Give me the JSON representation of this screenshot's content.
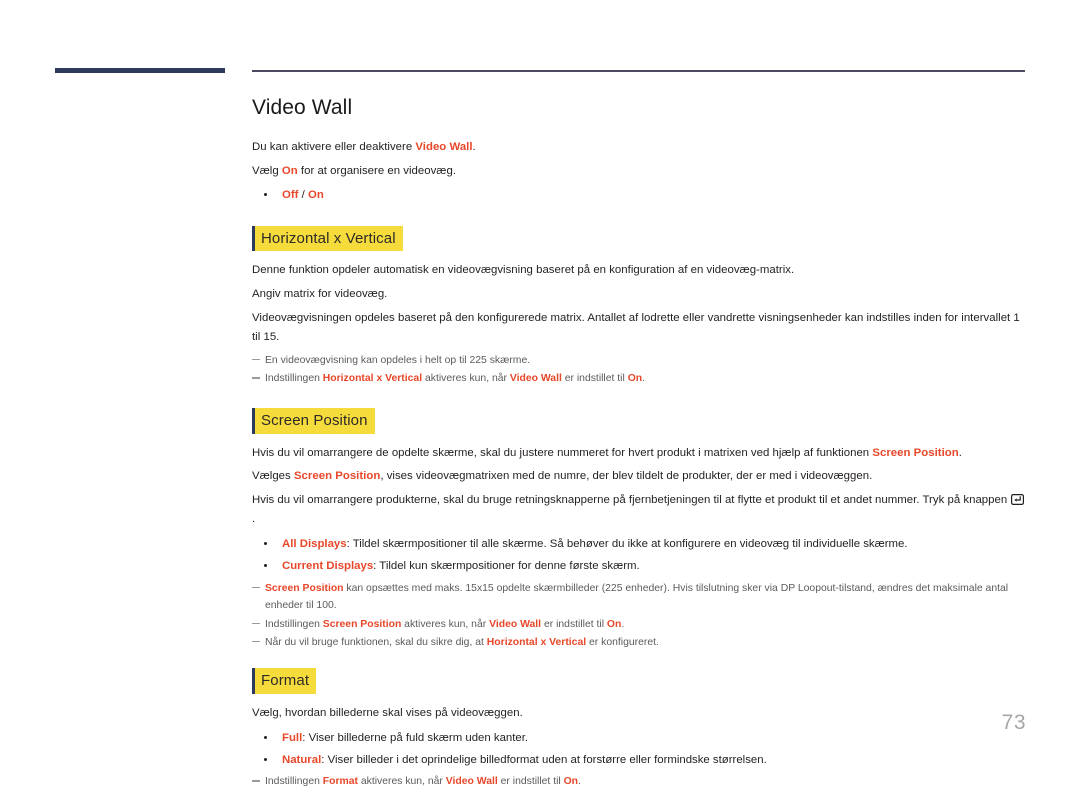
{
  "page": {
    "number": "73",
    "accent_color": "#e8472a",
    "highlight_color": "#f5dc3c",
    "rule_color": "#4a4a63",
    "margin_bar_color": "#2c3a5c"
  },
  "title": "Video Wall",
  "intro": {
    "line1_pre": "Du kan aktivere eller deaktivere ",
    "line1_accent": "Video Wall",
    "line1_post": ".",
    "line2_pre": "Vælg ",
    "line2_accent": "On",
    "line2_post": " for at organisere en videovæg.",
    "bullet1_a": "Off",
    "bullet1_sep": " / ",
    "bullet1_b": "On"
  },
  "sections": [
    {
      "heading": "Horizontal x Vertical",
      "p1": "Denne funktion opdeler automatisk en videovægvisning baseret på en konfiguration af en videovæg-matrix.",
      "p2": "Angiv matrix for videovæg.",
      "p3": "Videovægvisningen opdeles baseret på den konfigurerede matrix. Antallet af lodrette eller vandrette visningsenheder kan indstilles inden for intervallet 1 til 15.",
      "note1": "En videovægvisning kan opdeles i helt op til 225 skærme.",
      "note2_pre": "Indstillingen ",
      "note2_a": "Horizontal x Vertical",
      "note2_mid": " aktiveres kun, når ",
      "note2_b": "Video Wall",
      "note2_mid2": " er indstillet til ",
      "note2_c": "On",
      "note2_post": "."
    },
    {
      "heading": "Screen Position",
      "p1_pre": "Hvis du vil omarrangere de opdelte skærme, skal du justere nummeret for hvert produkt i matrixen ved hjælp af funktionen ",
      "p1_accent": "Screen Position",
      "p1_post": ".",
      "p2_pre": "Vælges ",
      "p2_accent": "Screen Position",
      "p2_post": ", vises videovægmatrixen med de numre, der blev tildelt de produkter, der er med i videovæggen.",
      "p3_pre": "Hvis du vil omarrangere produkterne, skal du bruge retningsknapperne på fjernbetjeningen til at flytte et produkt til et andet nummer. Tryk på knappen ",
      "p3_icon": "enter-key-icon",
      "p3_post": ".",
      "bullet1_accent": "All Displays",
      "bullet1_text": ": Tildel skærmpositioner til alle skærme. Så behøver du ikke at konfigurere en videovæg til individuelle skærme.",
      "bullet2_accent": "Current Displays",
      "bullet2_text": ": Tildel kun skærmpositioner for denne første skærm.",
      "note1_accent": "Screen Position",
      "note1_text": " kan opsættes med maks. 15x15 opdelte skærmbilleder (225 enheder). Hvis tilslutning sker via DP Loopout-tilstand, ændres det maksimale antal enheder til 100.",
      "note2_pre": "Indstillingen ",
      "note2_a": "Screen Position",
      "note2_mid": " aktiveres kun, når ",
      "note2_b": "Video Wall",
      "note2_mid2": " er indstillet til ",
      "note2_c": "On",
      "note2_post": ".",
      "note3_pre": "Når du vil bruge funktionen, skal du sikre dig, at ",
      "note3_a": "Horizontal x Vertical",
      "note3_post": " er konfigureret."
    },
    {
      "heading": "Format",
      "p1": "Vælg, hvordan billederne skal vises på videovæggen.",
      "bullet1_accent": "Full",
      "bullet1_text": ": Viser billederne på fuld skærm uden kanter.",
      "bullet2_accent": "Natural",
      "bullet2_text": ": Viser billeder i det oprindelige billedformat uden at forstørre eller formindske størrelsen.",
      "note1_pre": "Indstillingen ",
      "note1_a": "Format",
      "note1_mid": " aktiveres kun, når ",
      "note1_b": "Video Wall",
      "note1_mid2": " er indstillet til ",
      "note1_c": "On",
      "note1_post": "."
    }
  ]
}
